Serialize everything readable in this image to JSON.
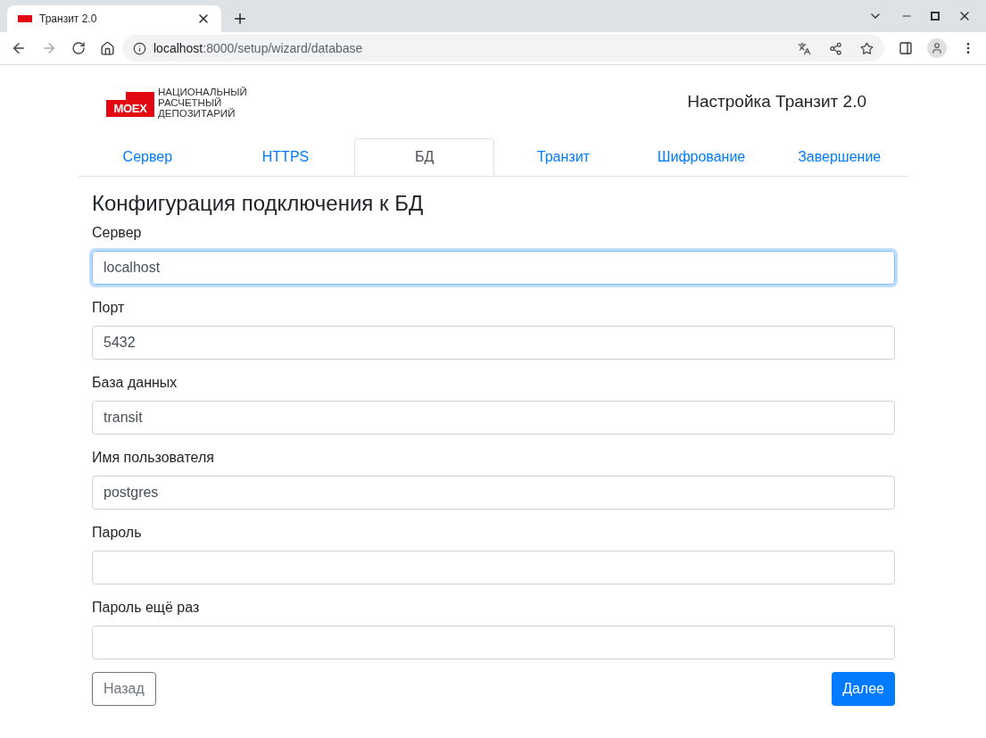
{
  "browser": {
    "tab_title": "Транзит 2.0",
    "url_host": "localhost",
    "url_path": ":8000/setup/wizard/database"
  },
  "header": {
    "logo_badge": "MOEX",
    "logo_lines": [
      "НАЦИОНАЛЬНЫЙ",
      "РАСЧЕТНЫЙ",
      "ДЕПОЗИТАРИЙ"
    ],
    "title": "Настройка Транзит 2.0"
  },
  "tabs": [
    {
      "label": "Сервер",
      "selected": false
    },
    {
      "label": "HTTPS",
      "selected": false
    },
    {
      "label": "БД",
      "selected": true
    },
    {
      "label": "Транзит",
      "selected": false
    },
    {
      "label": "Шифрование",
      "selected": false
    },
    {
      "label": "Завершение",
      "selected": false
    }
  ],
  "form": {
    "title": "Конфигурация подключения к БД",
    "fields": [
      {
        "label": "Сервер",
        "value": "localhost",
        "focused": true
      },
      {
        "label": "Порт",
        "value": "5432",
        "focused": false
      },
      {
        "label": "База данных",
        "value": "transit",
        "focused": false
      },
      {
        "label": "Имя пользователя",
        "value": "postgres",
        "focused": false
      },
      {
        "label": "Пароль",
        "focused": false
      },
      {
        "label": "Пароль ещё раз",
        "focused": false
      }
    ]
  },
  "buttons": {
    "back": "Назад",
    "next": "Далее"
  }
}
